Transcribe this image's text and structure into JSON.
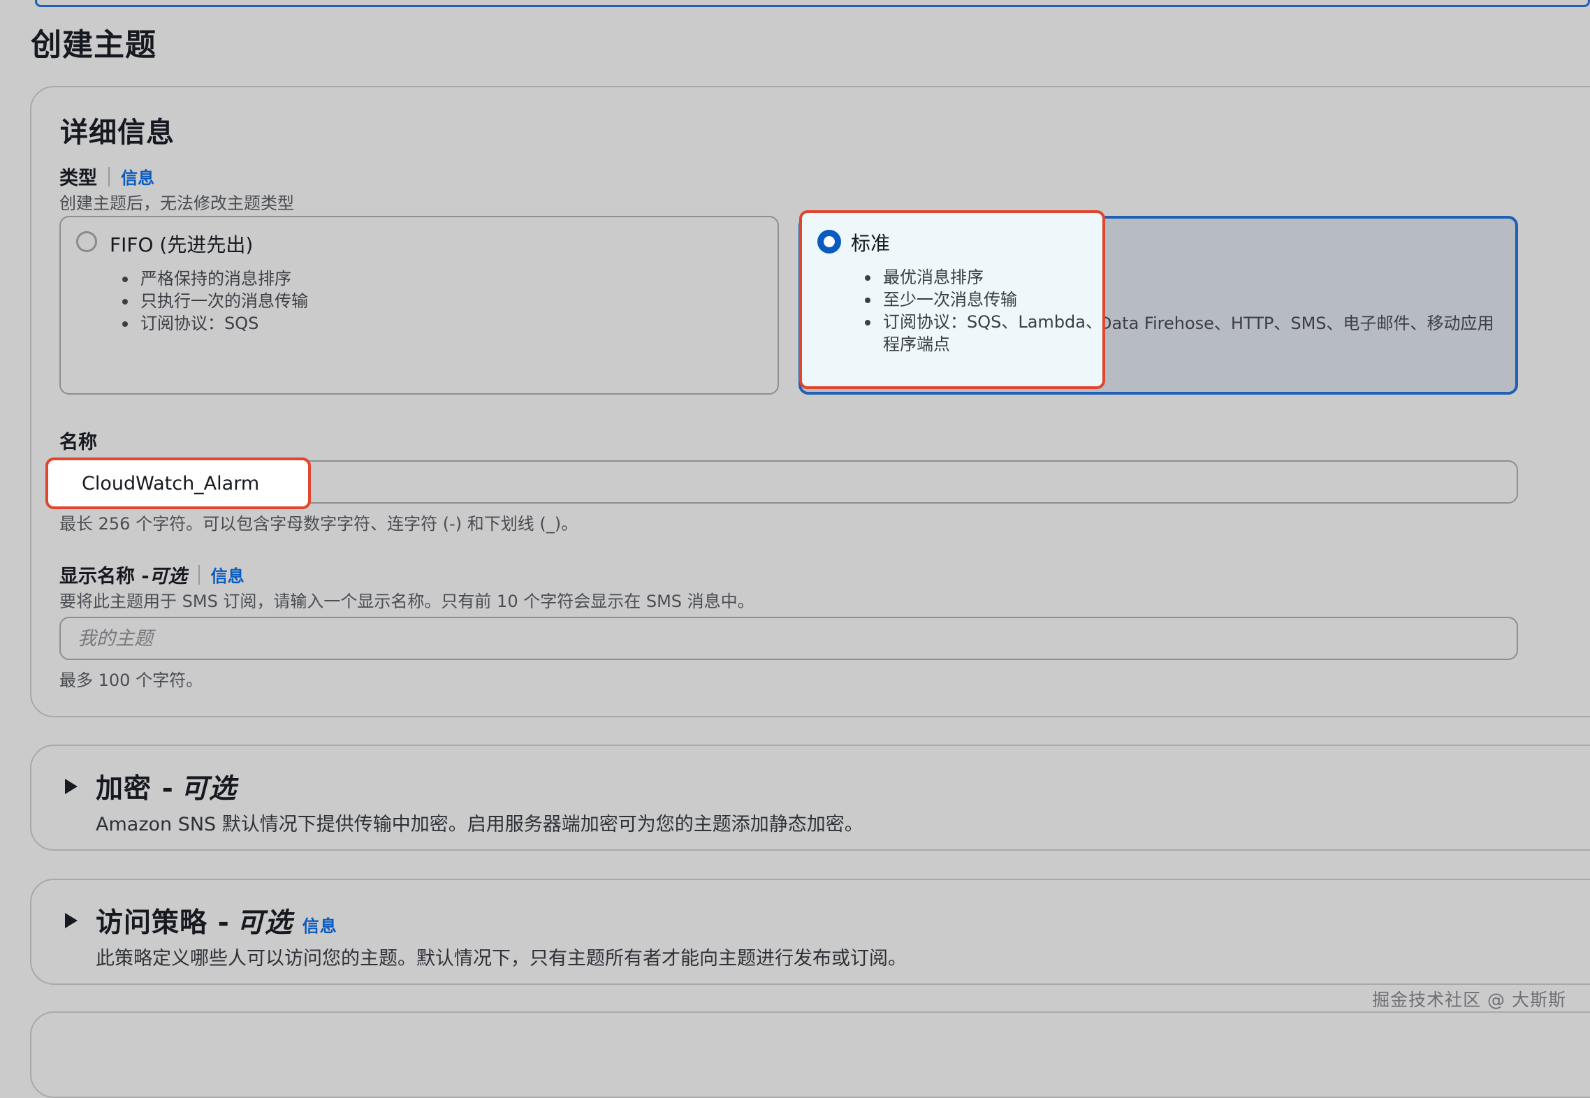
{
  "page": {
    "title": "创建主题"
  },
  "details": {
    "section_title": "详细信息",
    "type": {
      "label": "类型",
      "info": "信息",
      "hint": "创建主题后，无法修改主题类型",
      "options": [
        {
          "title": "FIFO (先进先出)",
          "selected": false,
          "bullets": [
            "严格保持的消息排序",
            "只执行一次的消息传输",
            "订阅协议：SQS"
          ]
        },
        {
          "title": "标准",
          "selected": true,
          "bullets": [
            "最优消息排序",
            "至少一次消息传输",
            "订阅协议：SQS、Lambda、Data Firehose、HTTP、SMS、电子邮件、移动应用程序端点"
          ]
        }
      ]
    },
    "name": {
      "label": "名称",
      "value": "CloudWatch_Alarm",
      "hint": "最长 256 个字符。可以包含字母数字字符、连字符 (-) 和下划线 (_)。"
    },
    "display_name": {
      "label": "显示名称 - ",
      "optional": "可选",
      "info": "信息",
      "description": "要将此主题用于 SMS 订阅，请输入一个显示名称。只有前 10 个字符会显示在 SMS 消息中。",
      "placeholder": "我的主题",
      "hint": "最多 100 个字符。"
    }
  },
  "encryption": {
    "title": "加密 - ",
    "optional": "可选",
    "description": "Amazon SNS 默认情况下提供传输中加密。启用服务器端加密可为您的主题添加静态加密。"
  },
  "access_policy": {
    "title": "访问策略 - ",
    "optional": "可选",
    "info": "信息",
    "description": "此策略定义哪些人可以访问您的主题。默认情况下，只有主题所有者才能向主题进行发布或订阅。"
  },
  "watermark": "掘金技术社区 @ 大斯斯",
  "colors": {
    "accent": "#0a5bbf",
    "highlight": "#e0452e",
    "background": "#cbcbcb"
  }
}
